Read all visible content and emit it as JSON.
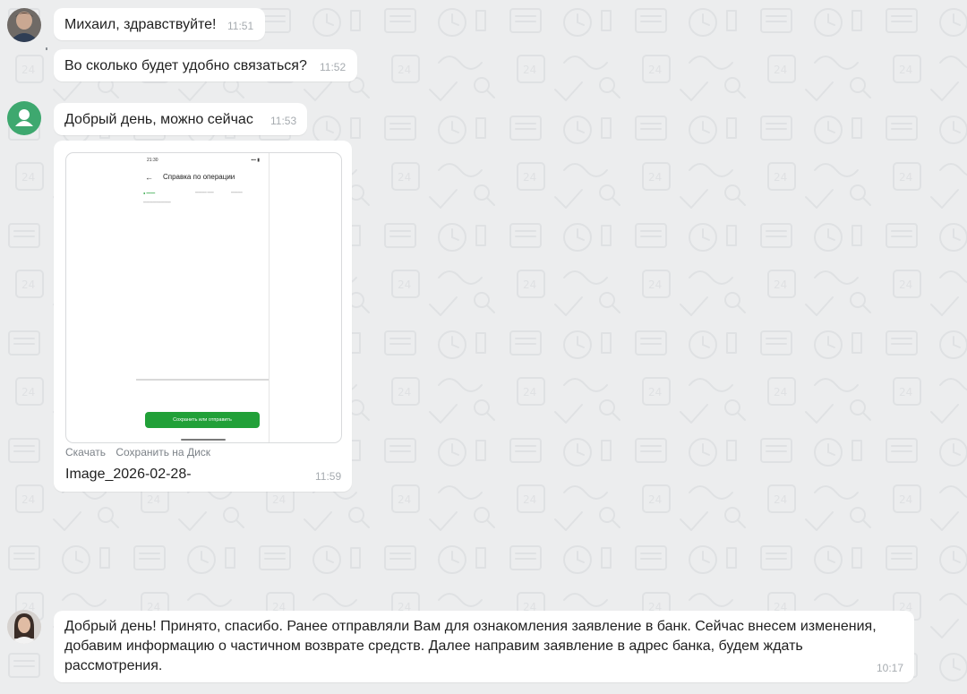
{
  "messages": [
    {
      "id": "m1",
      "text": "Михаил, здравствуйте!",
      "time": "11:51"
    },
    {
      "id": "m2",
      "text": "Во сколько будет удобно связаться?",
      "time": "11:52"
    },
    {
      "id": "m3",
      "text": "Добрый день, можно сейчас",
      "time": "11:53"
    },
    {
      "id": "m5",
      "text": "Добрый день! Принято, спасибо. Ранее отправляли Вам для ознакомления заявление в банк. Сейчас внесем изменения, добавим информацию о частичном возврате средств. Далее направим заявление в адрес банка, будем ждать рассмотрения.",
      "time": "10:17"
    }
  ],
  "attachment": {
    "time": "11:59",
    "download_label": "Скачать",
    "save_to_disk_label": "Сохранить на Диск",
    "filename": "Image_2026-02-28-",
    "preview": {
      "status_time": "21:30",
      "screen_title": "Справка по операции",
      "button_label": "Сохранить или отправить"
    }
  },
  "colors": {
    "background": "#ecedee",
    "bubble": "#ffffff",
    "time_text": "#a6abb0",
    "preview_button": "#21a038",
    "default_avatar": "#3ea86f"
  }
}
